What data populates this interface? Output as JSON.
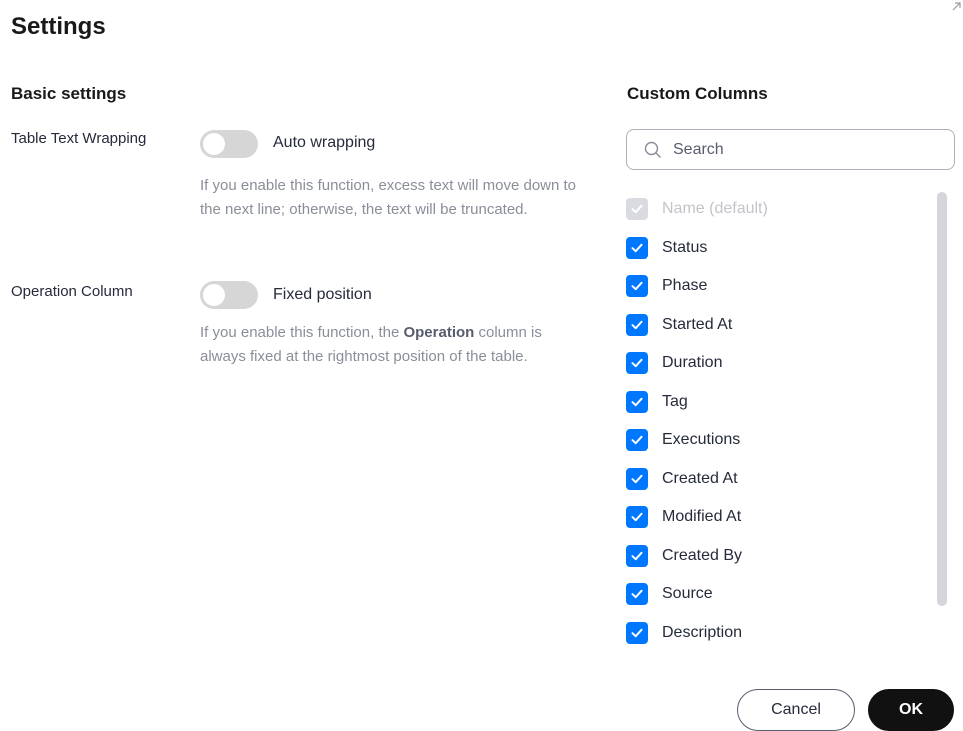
{
  "dialog": {
    "title": "Settings"
  },
  "basic": {
    "title": "Basic settings",
    "wrapping": {
      "label": "Table Text Wrapping",
      "toggle_label": "Auto wrapping",
      "enabled": false,
      "description": "If you enable this function, excess text will move down to the next line; otherwise, the text will be truncated."
    },
    "operation": {
      "label": "Operation Column",
      "toggle_label": "Fixed position",
      "enabled": false,
      "description_prefix": "If you enable this function, the ",
      "description_bold": "Operation",
      "description_suffix": " column is always fixed at the rightmost position of the table."
    }
  },
  "custom": {
    "title": "Custom Columns",
    "search_placeholder": "Search",
    "columns": [
      {
        "label": "Name (default)",
        "checked": true,
        "disabled": true
      },
      {
        "label": "Status",
        "checked": true,
        "disabled": false
      },
      {
        "label": "Phase",
        "checked": true,
        "disabled": false
      },
      {
        "label": "Started At",
        "checked": true,
        "disabled": false
      },
      {
        "label": "Duration",
        "checked": true,
        "disabled": false
      },
      {
        "label": "Tag",
        "checked": true,
        "disabled": false
      },
      {
        "label": "Executions",
        "checked": true,
        "disabled": false
      },
      {
        "label": "Created At",
        "checked": true,
        "disabled": false
      },
      {
        "label": "Modified At",
        "checked": true,
        "disabled": false
      },
      {
        "label": "Created By",
        "checked": true,
        "disabled": false
      },
      {
        "label": "Source",
        "checked": true,
        "disabled": false
      },
      {
        "label": "Description",
        "checked": true,
        "disabled": false
      }
    ]
  },
  "footer": {
    "cancel_label": "Cancel",
    "ok_label": "OK"
  },
  "colors": {
    "checkbox_blue": "#0077ff",
    "ok_button": "#111111"
  },
  "icons": {
    "expand": "expand-icon",
    "search": "search-icon",
    "check": "check-icon"
  }
}
